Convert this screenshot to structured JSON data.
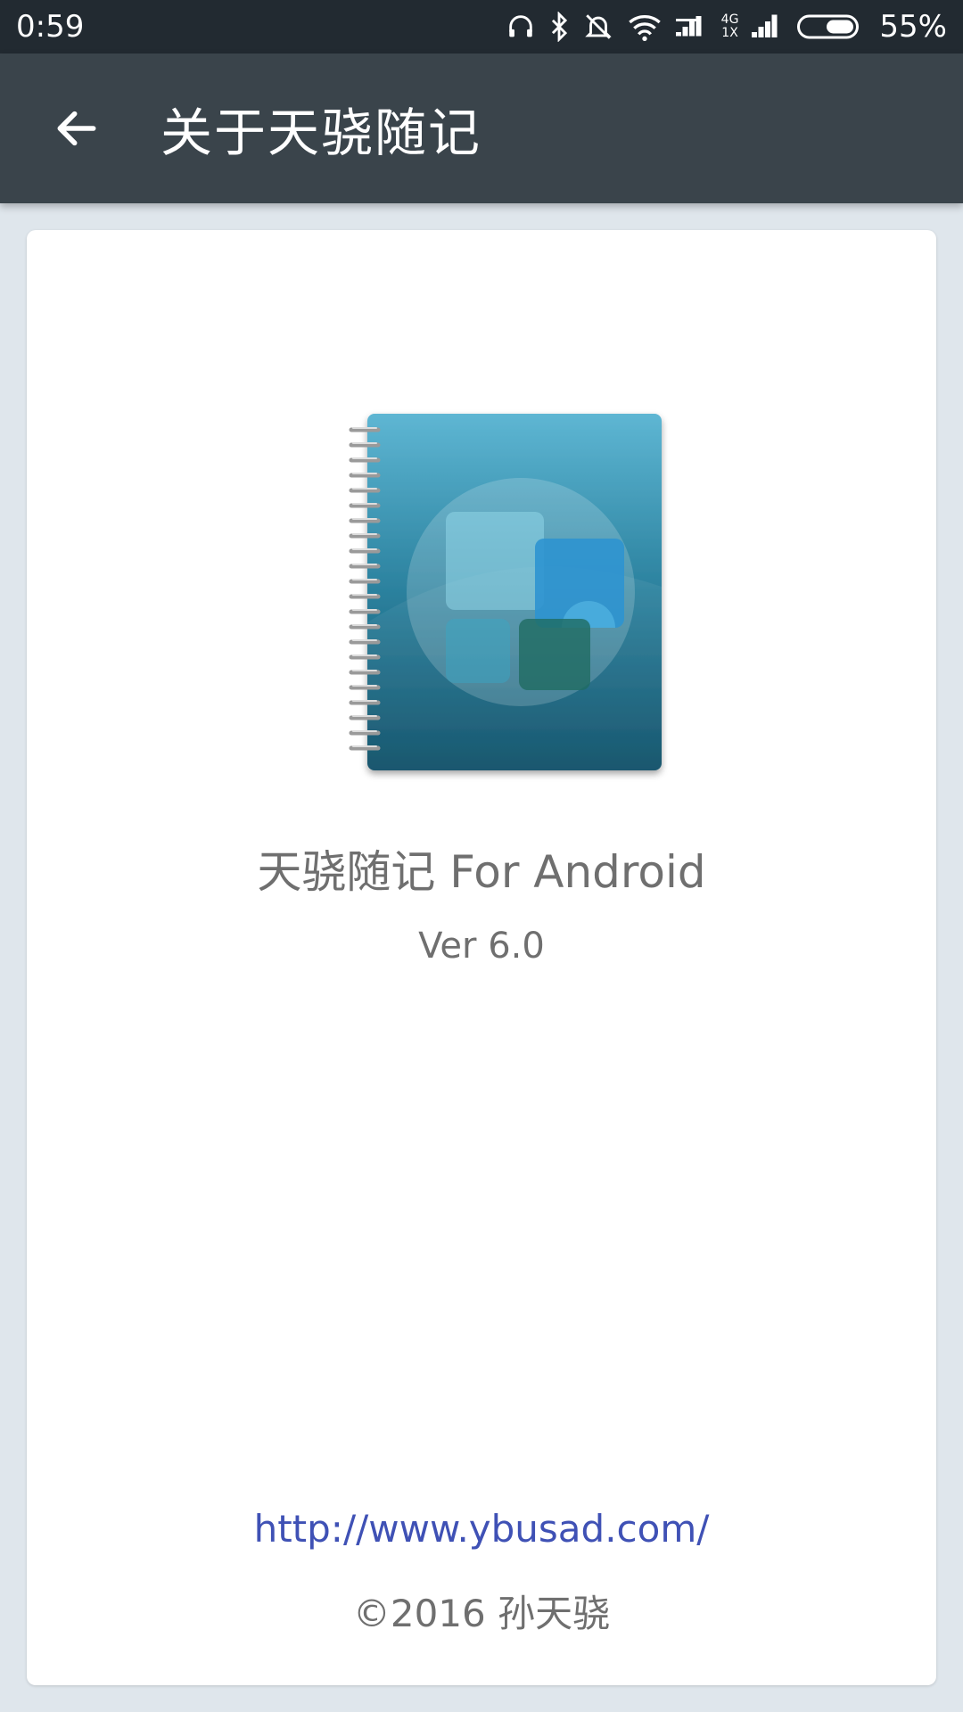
{
  "status_bar": {
    "time": "0:59",
    "network_top": "4G",
    "network_bottom": "1X",
    "battery_percent": "55%",
    "icons": [
      "headphones-icon",
      "bluetooth-icon",
      "silent-alarm-icon",
      "wifi-icon",
      "signal-icon",
      "signal-icon",
      "battery-icon"
    ]
  },
  "app_bar": {
    "back_icon": "arrow-left-icon",
    "title": "关于天骁随记"
  },
  "about": {
    "app_name": "天骁随记 For Android",
    "version": "Ver 6.0",
    "website": "http://www.ybusad.com/",
    "copyright": "©2016 孙天骁"
  },
  "colors": {
    "status_bar_bg": "#222a31",
    "app_bar_bg": "#3a444b",
    "page_bg": "#dfe6ec",
    "link": "#3f51b5",
    "secondary_text": "#6f6f6f",
    "notebook_top": "#5eb6d3",
    "notebook_bottom": "#0a4d66"
  }
}
